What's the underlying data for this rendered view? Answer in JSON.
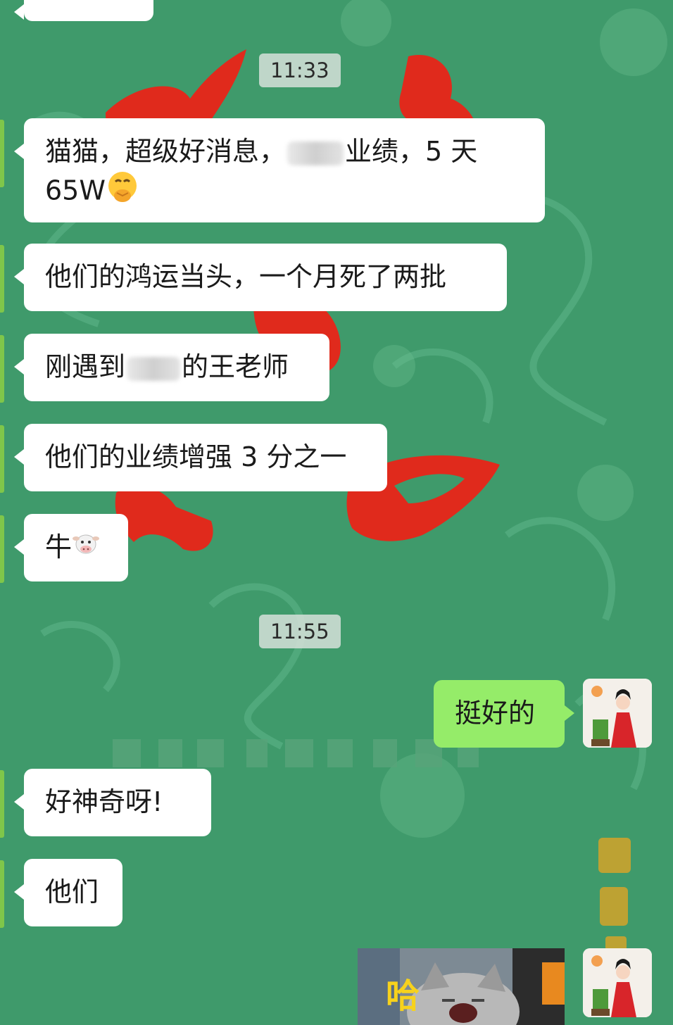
{
  "times": [
    "11:33",
    "11:55"
  ],
  "messages": {
    "m0": "",
    "m1_line1_a": "猫猫，超级好消息，",
    "m1_line1_b": "业绩，5 天",
    "m1_line2": "65W",
    "m1_emoji": "face-with-hand-over-mouth-emoji",
    "m2": "他们的鸿运当头，一个月死了两批",
    "m3_a": "刚遇到",
    "m3_b": "的王老师",
    "m4": "他们的业绩增强 3 分之一",
    "m5": "牛",
    "m5_emoji": "cow-face-emoji",
    "m6": "挺好的",
    "m7": "好神奇呀!",
    "m8": "他们"
  },
  "sticker": {
    "caption": "哈"
  },
  "colors": {
    "bg": "#3f9a6b",
    "incoming": "#ffffff",
    "outgoing": "#95ec69"
  }
}
